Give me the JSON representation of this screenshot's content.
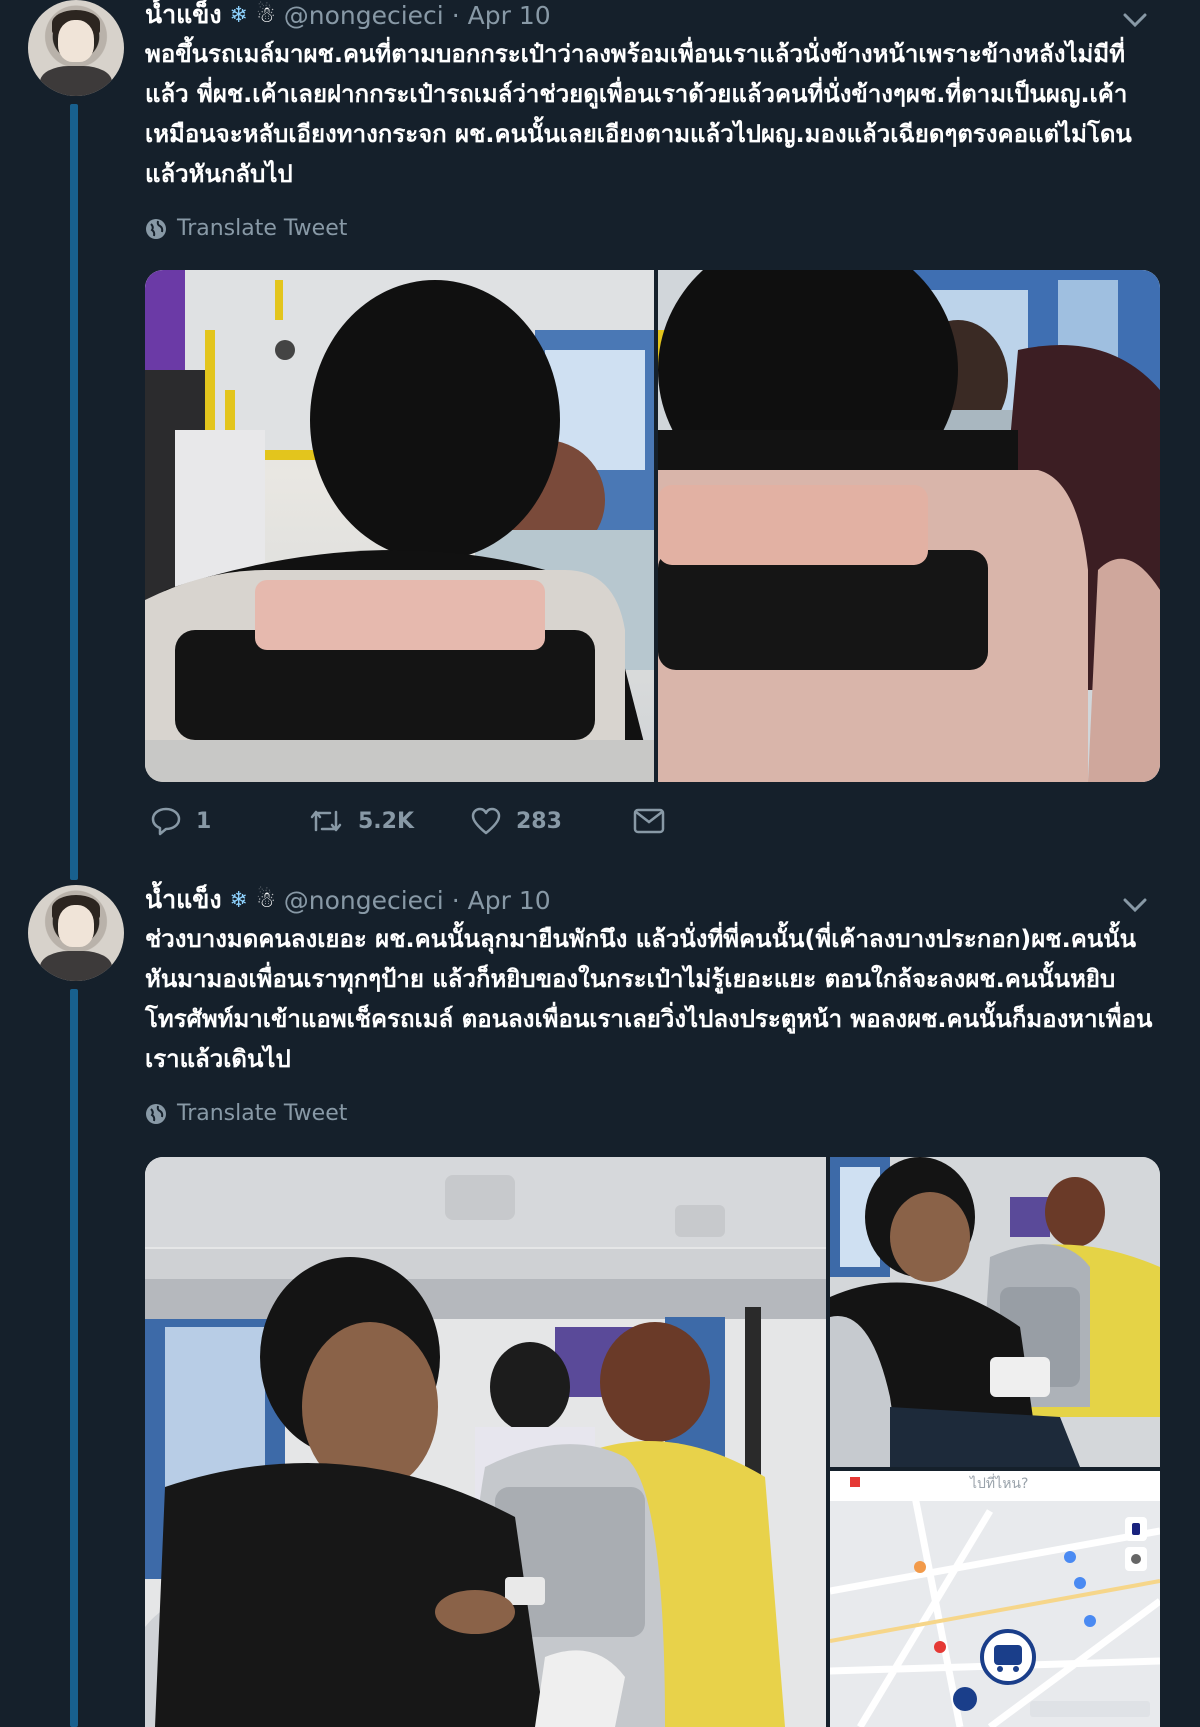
{
  "tweets": [
    {
      "display_name": "น้ำแข็ง",
      "emoji_1": "❄",
      "emoji_2": "☃",
      "handle": "@nongecieci",
      "separator": "·",
      "date": "Apr 10",
      "text": "พอขึ้นรถเมล์มาผช.คนที่ตามบอกกระเป๋าว่าลงพร้อมเพื่อนเราแล้วนั่งข้างหน้าเพราะข้างหลังไม่มีที่แล้ว พี่ผช.เค้าเลยฝากกระเป๋ารถเมล์ว่าช่วยดูเพื่อนเราด้วยแล้วคนที่นั่งข้างๆผช.ที่ตามเป็นผญ.เค้าเหมือนจะหลับเอียงทางกระจก ผช.คนนั้นเลยเอียงตามแล้วไปผญ.มองแล้วเฉียดๆตรงคอแต่ไม่โดนแล้วหันกลับไป",
      "translate_label": "Translate Tweet",
      "replies": "1",
      "retweets": "5.2K",
      "likes": "283"
    },
    {
      "display_name": "น้ำแข็ง",
      "emoji_1": "❄",
      "emoji_2": "☃",
      "handle": "@nongecieci",
      "separator": "·",
      "date": "Apr 10",
      "text": "ช่วงบางมดคนลงเยอะ ผช.คนนั้นลุกมายืนพักนึง แล้วนั่งที่พี่คนนั้น(พี่เค้าลงบางประกอก)ผช.คนนั้นหันมามองเพื่อนเราทุกๆป้าย แล้วก็หยิบของในกระเป๋าไม่รู้เยอะแยะ ตอนใกล้จะลงผช.คนนั้นหยิบโทรศัพท์มาเข้าแอพเช็ครถเมล์ ตอนลงเพื่อนเราเลยวิ่งไปลงประตูหน้า พอลงผช.คนนั้นก็มองหาเพื่อนเราแล้วเดินไป",
      "translate_label": "Translate Tweet",
      "map_text": "ไปที่ไหน?"
    }
  ],
  "colors": {
    "background": "#15202b",
    "text": "#ffffff",
    "muted": "#8899a6",
    "thread_line": "#1b95e0"
  },
  "icons": [
    "reply-icon",
    "retweet-icon",
    "like-icon",
    "dm-icon",
    "globe-icon",
    "chevron-down-icon",
    "bus-icon"
  ]
}
